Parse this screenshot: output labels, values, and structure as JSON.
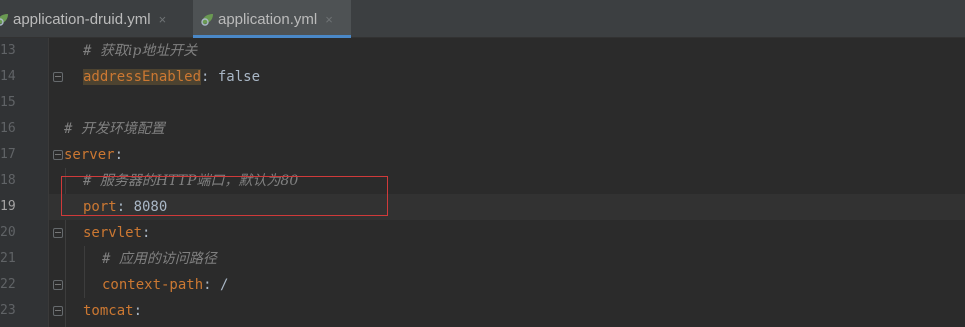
{
  "tabs": [
    {
      "label": "application-druid.yml",
      "close": "×",
      "active": false,
      "icon": "yaml-spring-icon"
    },
    {
      "label": "application.yml",
      "close": "×",
      "active": true,
      "icon": "yaml-spring-icon"
    }
  ],
  "current_line": "19",
  "lines": [
    {
      "num": "13",
      "comment": "# ",
      "comment_cn": "获取ip地址开关"
    },
    {
      "num": "14",
      "key": "addressEnabled",
      "sep": ": ",
      "value": "false"
    },
    {
      "num": "15"
    },
    {
      "num": "16",
      "comment": "# ",
      "comment_cn": "开发环境配置"
    },
    {
      "num": "17",
      "key": "server",
      "sep": ":"
    },
    {
      "num": "18",
      "comment": "# ",
      "comment_cn": "服务器的HTTP端口，默认为80"
    },
    {
      "num": "19",
      "key": "port",
      "sep": ": ",
      "value": "8080"
    },
    {
      "num": "20",
      "key": "servlet",
      "sep": ":"
    },
    {
      "num": "21",
      "comment": "# ",
      "comment_cn": "应用的访问路径"
    },
    {
      "num": "22",
      "key": "context-path",
      "sep": ": ",
      "value": "/"
    },
    {
      "num": "23",
      "key": "tomcat",
      "sep": ":"
    }
  ],
  "colors": {
    "background": "#2b2b2b",
    "key": "#cc7832",
    "comment": "#808080",
    "text": "#a9b7c6",
    "highlight_box": "#d03a3a",
    "active_tab_underline": "#4a88c7"
  }
}
